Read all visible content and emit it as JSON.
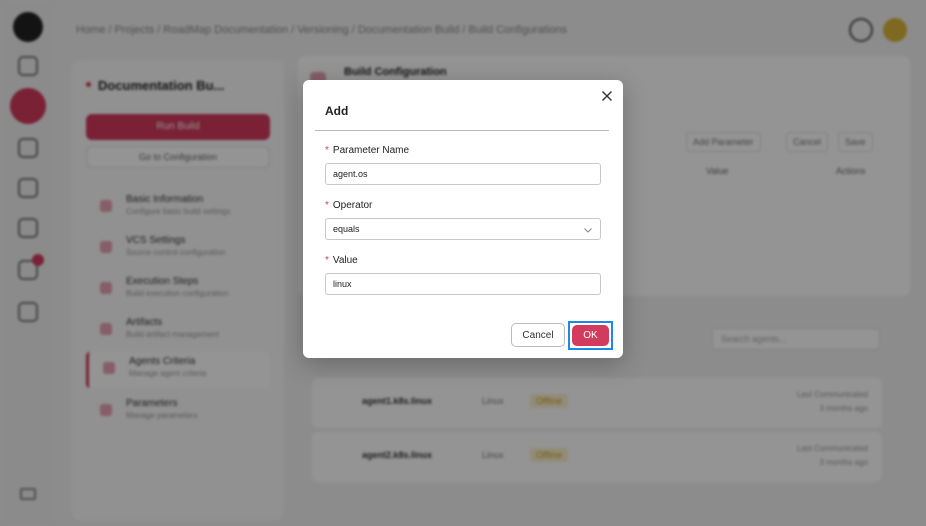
{
  "background": {
    "breadcrumb": "Home / Projects / RoadMap Documentation / Versioning / Documentation Build / Build Configurations",
    "left_panel": {
      "title": "Documentation Bu...",
      "run_button": "Run Build",
      "config_button": "Go to Configuration",
      "items": [
        {
          "label": "Basic Information",
          "sub": "Configure basic build settings"
        },
        {
          "label": "VCS Settings",
          "sub": "Source control configuration"
        },
        {
          "label": "Execution Steps",
          "sub": "Build execution configuration"
        },
        {
          "label": "Artifacts",
          "sub": "Build artifact management"
        },
        {
          "label": "Agents Criteria",
          "sub": "Manage agent criteria"
        },
        {
          "label": "Parameters",
          "sub": "Manage parameters"
        }
      ]
    },
    "main": {
      "title": "Build Configuration",
      "add_parameter": "Add Parameter",
      "cancel": "Cancel",
      "save": "Save",
      "col_value": "Value",
      "col_actions": "Actions",
      "search_placeholder": "Search agents...",
      "agents": [
        {
          "name": "agent1.k8s.linux",
          "os": "Linux",
          "status": "Offline",
          "time_label": "Last Communicated",
          "time": "3 months ago"
        },
        {
          "name": "agent2.k8s.linux",
          "os": "Linux",
          "status": "Offline",
          "time_label": "Last Communicated",
          "time": "3 months ago"
        }
      ]
    }
  },
  "modal": {
    "title": "Add",
    "fields": {
      "param_name": {
        "label": "Parameter Name",
        "value": "agent.os"
      },
      "operator": {
        "label": "Operator",
        "value": "equals"
      },
      "value": {
        "label": "Value",
        "value": "linux"
      }
    },
    "required_mark": "*",
    "cancel_label": "Cancel",
    "ok_label": "OK"
  },
  "colors": {
    "accent": "#d23a5e",
    "focus_outline": "#1e88e5"
  }
}
